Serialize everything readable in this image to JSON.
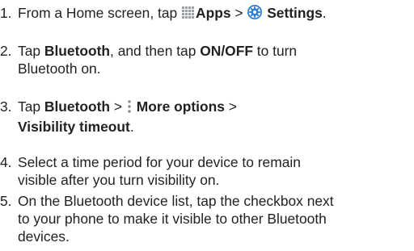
{
  "steps": [
    {
      "number": "1.",
      "text_a": "From a Home screen, tap",
      "apps_label": "Apps",
      "sep": ">",
      "settings_label": "Settings",
      "end": ".",
      "apps_icon": "apps-grid-icon",
      "settings_icon": "settings-gear-icon"
    },
    {
      "number": "2.",
      "line1_a": "Tap",
      "bluetooth_label": "Bluetooth",
      "line1_b": ", and then tap",
      "onoff_label": "ON/OFF",
      "line1_c": "to turn",
      "line2": "Bluetooth on."
    },
    {
      "number": "3.",
      "line1_a": "Tap",
      "bluetooth_label": "Bluetooth",
      "sep1": ">",
      "more_options_label": "More options",
      "sep2": ">",
      "visibility_label": "Visibility timeout",
      "end": ".",
      "more_icon": "more-options-icon"
    },
    {
      "number": "4.",
      "line1": "Select a time period for your device to remain",
      "line2": "visible after you turn visibility on."
    },
    {
      "number": "5.",
      "line1": "On the Bluetooth device list, tap the checkbox next",
      "line2": "to your phone to make it visible to other Bluetooth",
      "line3": "devices."
    }
  ]
}
